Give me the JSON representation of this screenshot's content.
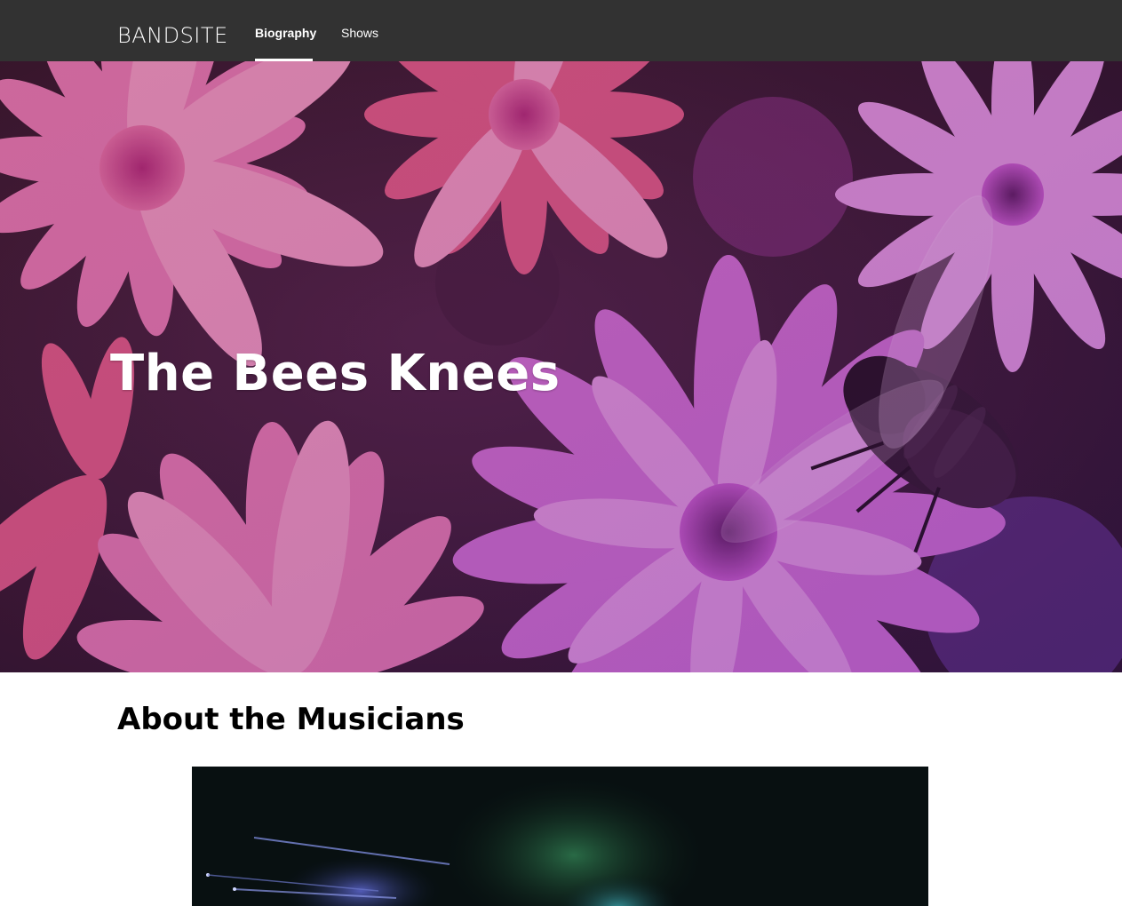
{
  "header": {
    "brand": "BANDSITE",
    "nav": [
      {
        "label": "Biography",
        "active": true
      },
      {
        "label": "Shows",
        "active": false
      }
    ]
  },
  "hero": {
    "title": "The Bees Knees",
    "image": "pink-flowers-with-bee"
  },
  "about": {
    "title": "About the Musicians",
    "image": "concert-stage-lights"
  },
  "colors": {
    "header_bg": "#323232",
    "text_light": "#ffffff",
    "text_dark": "#000000",
    "hero_pink": "#d85aa8",
    "hero_magenta": "#c04fd0"
  }
}
